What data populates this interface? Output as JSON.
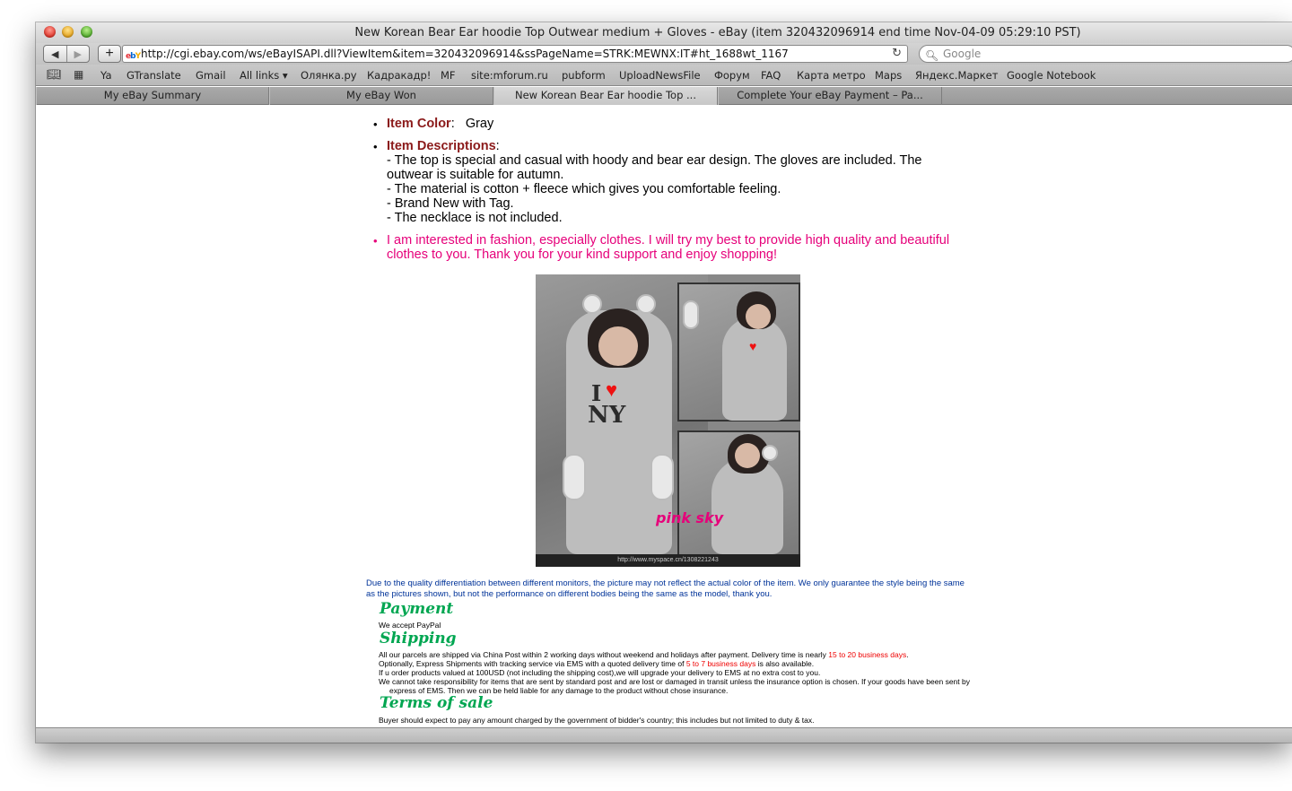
{
  "window": {
    "title": "New Korean Bear Ear hoodie Top Outwear medium + Gloves - eBay (item 320432096914 end time Nov-04-09 05:29:10 PST)"
  },
  "toolbar": {
    "back": "◀",
    "forward": "▶",
    "add": "+",
    "url": "http://cgi.ebay.com/ws/eBayISAPI.dll?ViewItem&item=320432096914&ssPageName=STRK:MEWNX:IT#ht_1688wt_1167",
    "search_placeholder": "Google"
  },
  "bookmarks": [
    "Ya",
    "GTranslate",
    "Gmail",
    "All links ▾",
    "Олянка.ру",
    "Кадракадр!",
    "MF",
    "site:mforum.ru",
    "pubform",
    "UploadNewsFile",
    "Форум",
    "FAQ",
    "Карта метро",
    "Maps",
    "Яндекс.Маркет",
    "Google Notebook"
  ],
  "tabs": [
    "My eBay Summary",
    "My eBay Won",
    "New Korean Bear Ear hoodie Top ...",
    "Complete Your eBay Payment – Pa..."
  ],
  "listing": {
    "color_label": "Item Color",
    "color_value": "Gray",
    "desc_label": "Item Descriptions",
    "desc_lines": [
      "- The top is special and casual with hoody and bear ear design. The gloves are included. The outwear is suitable for autumn.",
      "- The material is cotton + fleece which gives you comfortable feeling.",
      "- Brand New with Tag.",
      "- The necklace is not included."
    ],
    "seller_note": "I am interested in fashion, especially clothes. I will try my best to provide high quality and beautiful clothes to you.  Thank you for your kind support and enjoy shopping!",
    "photo_caption": "http://www.myspace.cn/1308221243",
    "photo_watermark": "pink sky",
    "disclaimer": "Due to the quality differentiation between different monitors, the picture may not reflect the actual color of the item. We only guarantee the style being the same as the pictures shown, but not the performance on different bodies being the same as the model, thank you."
  },
  "payment": {
    "heading": "Payment",
    "text": "We accept PayPal"
  },
  "shipping": {
    "heading": "Shipping",
    "line1_a": "All our parcels are shipped via China Post within 2 working days without weekend and holidays after payment. Delivery time is nearly ",
    "line1_red": "15 to 20 business days",
    "line1_b": ".",
    "line2_a": "Optionally, Express Shipments with tracking service via EMS with a quoted delivery time of ",
    "line2_red": "5 to 7 business days",
    "line2_b": " is also available.",
    "line3": "If u order products valued at 100USD (not including the shipping cost),we will upgrade your delivery to EMS at no extra cost  to you.",
    "line4": "We cannot take responsibility for items that are sent by standard post and are lost or damaged in transit unless the insurance option is chosen. If your goods have been sent by express of EMS. Then we can be held liable for any damage to the product without chose insurance."
  },
  "terms": {
    "heading": "Terms of sale",
    "line1": "Buyer should expect to pay any amount charged by the government of bidder's country; this includes but not limited to duty & tax."
  }
}
